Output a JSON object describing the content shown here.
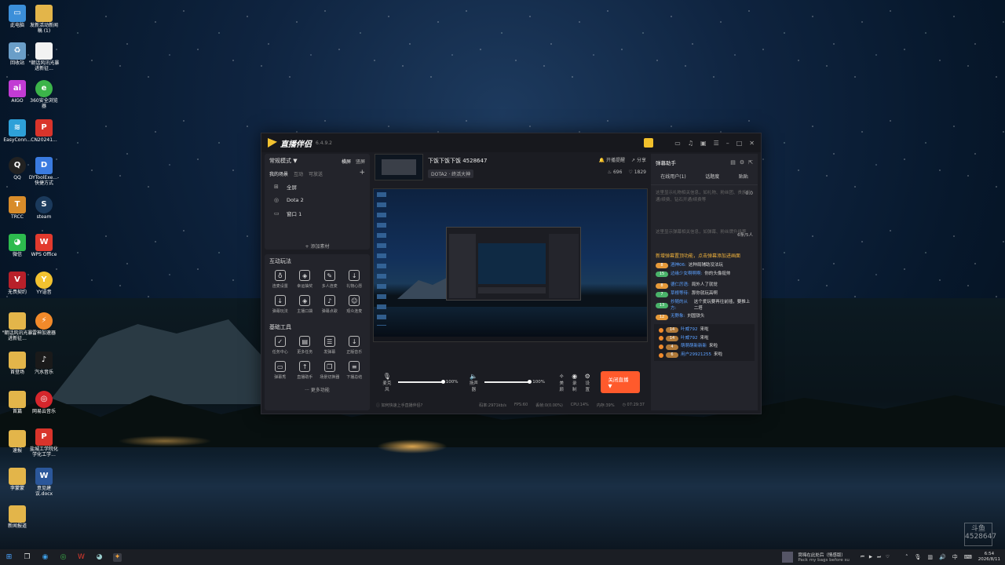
{
  "desktop": {
    "icons": [
      {
        "label": "此电脑",
        "x": 0
      },
      {
        "label": "发新活动新闻稿 (1)"
      },
      {
        "label": "回收站"
      },
      {
        "label": "\"朝话风讯光暴进新征..."
      },
      {
        "label": "AIGO"
      },
      {
        "label": "360安全浏览器"
      },
      {
        "label": "EasyConn..."
      },
      {
        "label": "CN20241..."
      },
      {
        "label": "QQ"
      },
      {
        "label": "DYToolExe...-快捷方式"
      },
      {
        "label": "TRCC"
      },
      {
        "label": "steam"
      },
      {
        "label": "微信"
      },
      {
        "label": "WPS Office"
      },
      {
        "label": "无畏契约"
      },
      {
        "label": "YY语音"
      },
      {
        "label": "\"朝话风讯光暴进新征..."
      },
      {
        "label": "雷神加速器"
      },
      {
        "label": "首登场"
      },
      {
        "label": "汽水音乐"
      },
      {
        "label": "首篇"
      },
      {
        "label": "网易云音乐"
      },
      {
        "label": "速报"
      },
      {
        "label": "盐城工学院化学化工学..."
      },
      {
        "label": "李蒙蒙"
      },
      {
        "label": "意见建议.docx"
      },
      {
        "label": "新闻报道"
      }
    ]
  },
  "app": {
    "title": "直播伴侣",
    "version": "6.4.9.2",
    "mode": "常规模式 ▼",
    "orientation": {
      "h": "横屏",
      "v": "竖屏"
    },
    "scene_tabs": [
      "我的场景",
      "互动",
      "可放送"
    ],
    "scenes": [
      {
        "icon": "⊞",
        "label": "全屏"
      },
      {
        "icon": "◎",
        "label": "Dota 2"
      },
      {
        "icon": "▭",
        "label": "窗口 1"
      }
    ],
    "add_source": "+ 添加素材",
    "interactive_title": "互动玩法",
    "interactive_tools": [
      "连麦设置",
      "幸运抽奖",
      "多人连麦",
      "礼物心愿",
      "弹幕玩法",
      "主播口袋",
      "弹幕点歌",
      "观众连麦"
    ],
    "basic_title": "基础工具",
    "basic_tools": [
      "任务中心",
      "更多任务",
      "发弹幕",
      "正版音乐",
      "弹幕秀",
      "直播助手",
      "场景切换器",
      "下播总结"
    ],
    "more_functions": "··· 更多功能",
    "stream": {
      "title": "下饭下饭下饭 4528647",
      "category": "DOTA2 · 终活大神",
      "start_reminder": "开播提醒",
      "share": "分享",
      "fire_count": "696",
      "likes": "1829"
    },
    "controls": {
      "mic_label": "麦克风",
      "mic_volume": "100%",
      "speaker_label": "扬声器",
      "speaker_volume": "100%",
      "beauty": "美颜",
      "record": "录制",
      "settings": "设置",
      "live_button": "关闭直播 ▼",
      "mic_level": 1.0,
      "speaker_level": 1.0
    },
    "status_bar": {
      "hint": "如何快速上手直播伴侣?",
      "bitrate": "码率:2971kb/s",
      "fps": "FPS:60",
      "dropped": "丢帧:0(0.00%)",
      "cpu": "CPU:14%",
      "mem": "内存:39%",
      "time": "07:29:37"
    },
    "danmu": {
      "title": "弹幕助手",
      "tabs": [
        "在线用户(1)",
        "话题度",
        "贴贴"
      ],
      "tip1": "这里显示礼物相关信息，如礼物、粉丝团、贵族开通/续费、钻石开通/续费等",
      "tip1_count": "0.0",
      "tip2": "这里显示弹幕相关信息，如弹幕、粉丝牌升级等",
      "tip2_count": "6条/5人",
      "notice": "新增弹幕置顶功能，点击弹幕添加进画面",
      "messages": [
        {
          "level": "8",
          "user": "酒神06:",
          "text": "这种局辅助没法玩",
          "color": "#e69a3a"
        },
        {
          "level": "15",
          "user": "边缘少女啊啊啊:",
          "text": "你的头像挺帅",
          "color": "#4ab36a"
        },
        {
          "level": "8",
          "user": "德仁厉语:",
          "text": "局外人了就觉",
          "color": "#e69a3a"
        },
        {
          "level": "7",
          "user": "草根等待:",
          "text": "那你就玩高啊",
          "color": "#4ab36a"
        },
        {
          "level": "13",
          "user": "抄随的从方:",
          "text": "这个爱玩要再往前插，要推上二塔",
          "color": "#4ab36a"
        },
        {
          "level": "12",
          "user": "无野象:",
          "text": "刘国铁头",
          "color": "#e69a3a"
        }
      ],
      "enters": [
        {
          "level": "14",
          "user": "叶威792",
          "text": "来啦"
        },
        {
          "level": "14",
          "user": "叶威792",
          "text": "来啦"
        },
        {
          "level": "4",
          "user": "萌萌萌新新新",
          "text": "来啦"
        },
        {
          "level": "6",
          "user": "用户29921255",
          "text": "来啦"
        }
      ]
    }
  },
  "taskbar": {
    "media_title": "窝嗨在此处后（情感版）",
    "media_sub": "Pack my bags before su",
    "ime": "中",
    "time": "6:54",
    "date": "2026/8/11"
  },
  "watermark": "斗鱼\n4528647"
}
